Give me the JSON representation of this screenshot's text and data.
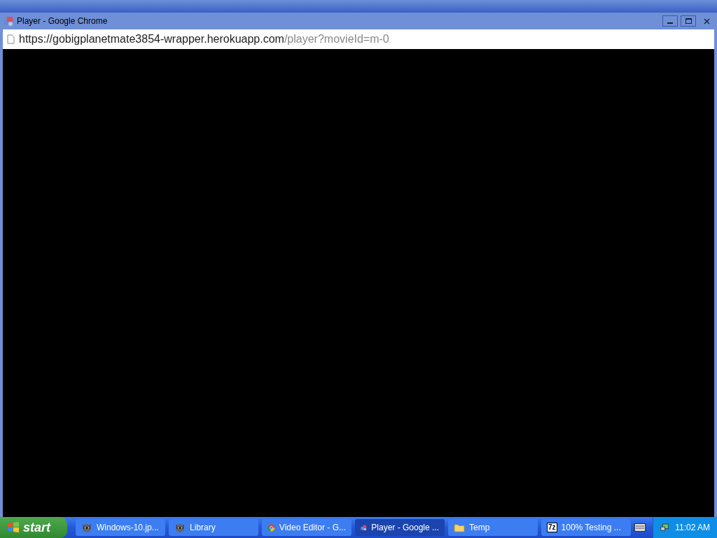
{
  "window": {
    "title": "Player - Google Chrome"
  },
  "address_bar": {
    "host": "https://gobigplanetmate3854-wrapper.herokuapp.com",
    "path": "/player?movieId=m-0"
  },
  "taskbar": {
    "start": "start",
    "items": [
      {
        "kind": "animal",
        "label": "Windows-10.jp...",
        "selected": false
      },
      {
        "kind": "animal",
        "label": "Library",
        "selected": false
      },
      {
        "kind": "chrome",
        "label": "Video Editor - G...",
        "selected": false
      },
      {
        "kind": "player",
        "label": "Player - Google ...",
        "selected": true
      },
      {
        "kind": "folder",
        "label": "Temp",
        "selected": false
      },
      {
        "kind": "archive",
        "badge": "7z",
        "label": "100% Testing ...",
        "selected": false
      }
    ],
    "clock": "11:02 AM"
  }
}
